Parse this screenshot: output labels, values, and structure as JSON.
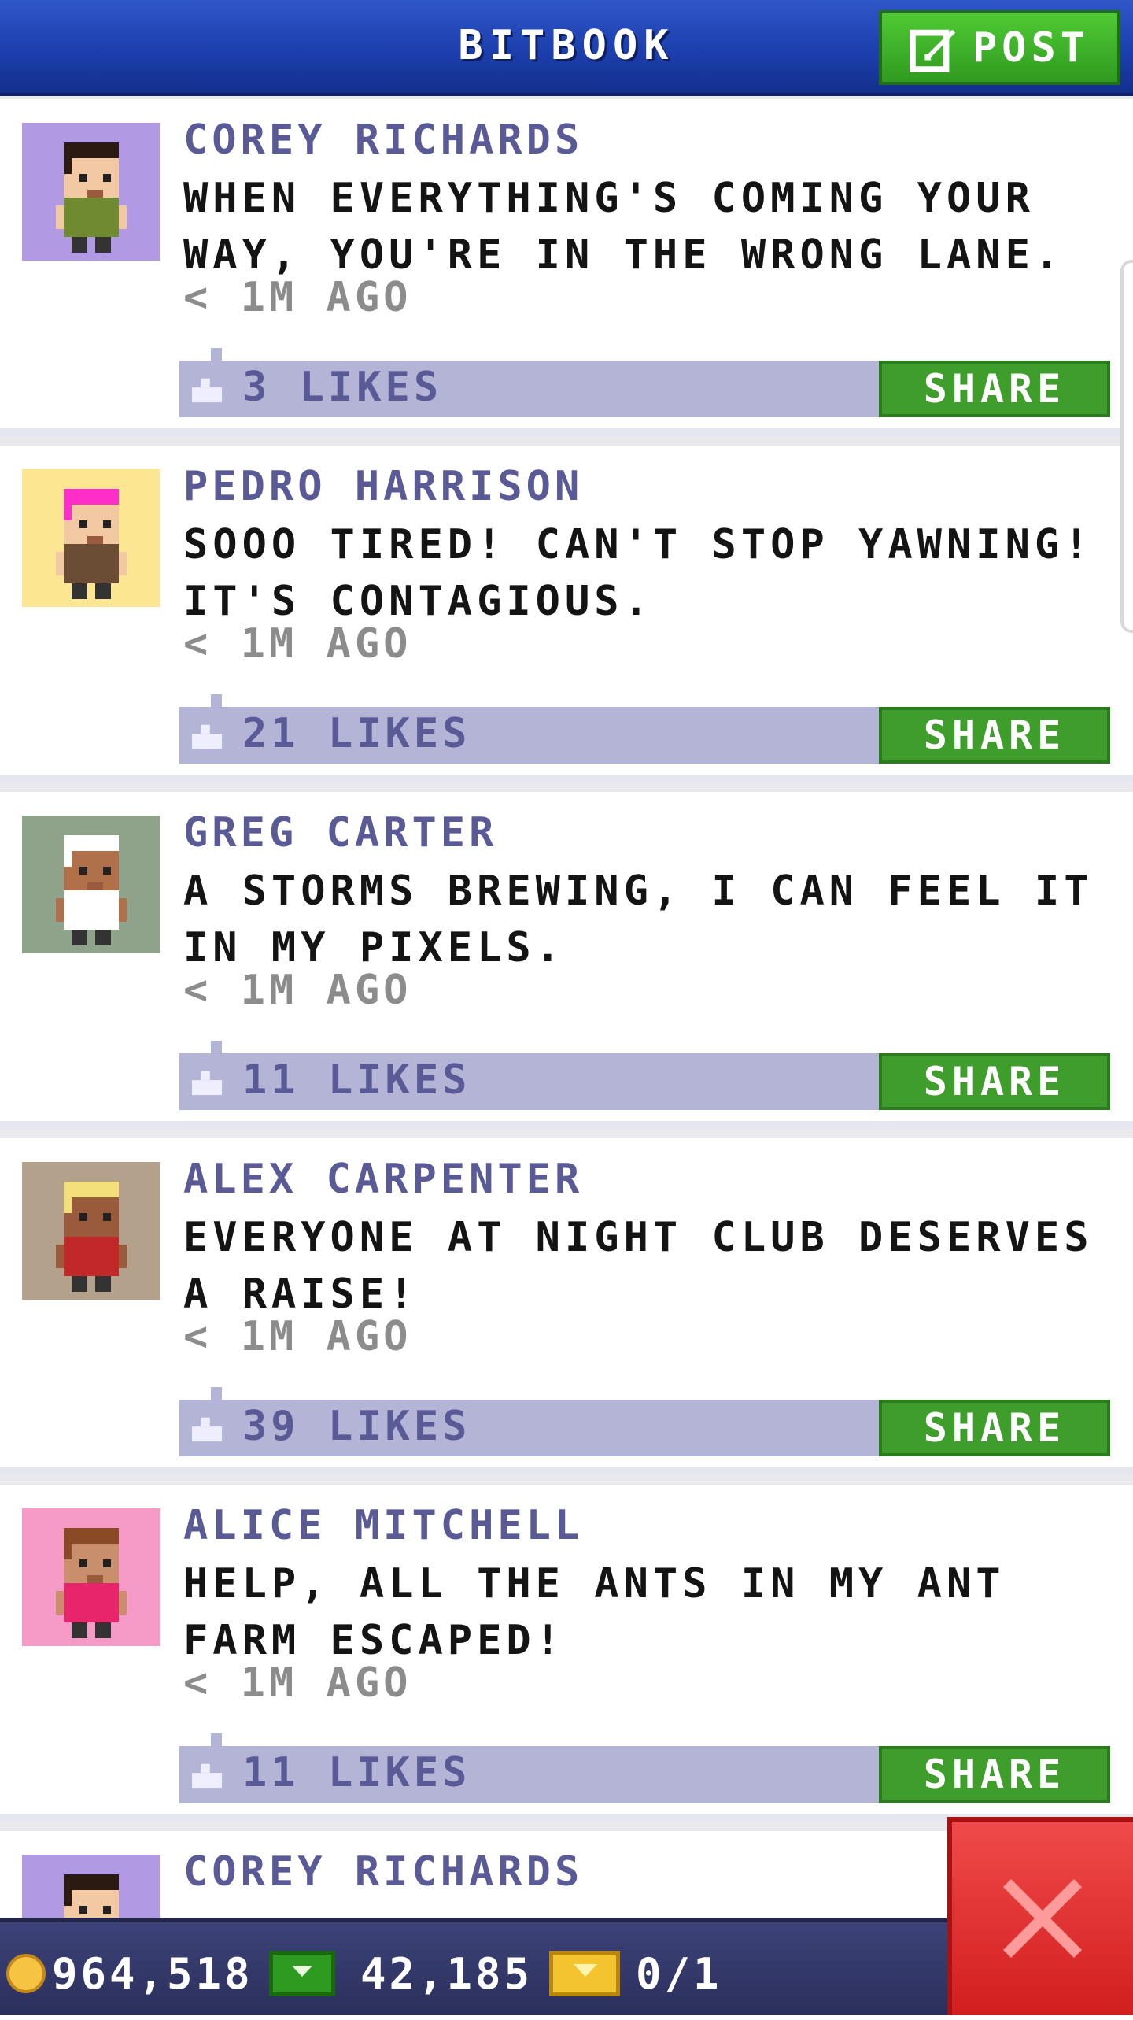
{
  "header": {
    "title": "BITBOOK",
    "post_label": "POST"
  },
  "posts": [
    {
      "author": "COREY RICHARDS",
      "text": "WHEN EVERYTHING'S COMING YOUR WAY, YOU'RE IN THE WRONG LANE.",
      "time": "< 1M AGO",
      "likes": "3 LIKES",
      "share": "SHARE",
      "avatar_bg": "#b19ae3",
      "avatar_shirt": "#6f8a2f",
      "avatar_hair": "#2a1a12",
      "avatar_skin": "#f2c9a3"
    },
    {
      "author": "PEDRO HARRISON",
      "text": "SOOO TIRED! CAN'T STOP YAWNING! IT'S CONTAGIOUS.",
      "time": "< 1M AGO",
      "likes": "21 LIKES",
      "share": "SHARE",
      "avatar_bg": "#fde692",
      "avatar_shirt": "#6b4c35",
      "avatar_hair": "#ff2ec8",
      "avatar_skin": "#f2c9a3"
    },
    {
      "author": "GREG CARTER",
      "text": "A STORMS BREWING, I CAN FEEL IT IN MY PIXELS.",
      "time": "< 1M AGO",
      "likes": "11 LIKES",
      "share": "SHARE",
      "avatar_bg": "#8fa28a",
      "avatar_shirt": "#ffffff",
      "avatar_hair": "#ffffff",
      "avatar_skin": "#b0714a"
    },
    {
      "author": "ALEX CARPENTER",
      "text": "EVERYONE AT NIGHT CLUB DESERVES A RAISE!",
      "time": "< 1M AGO",
      "likes": "39 LIKES",
      "share": "SHARE",
      "avatar_bg": "#b3a18b",
      "avatar_shirt": "#c0282a",
      "avatar_hair": "#f3e07a",
      "avatar_skin": "#9a5a3c"
    },
    {
      "author": "ALICE MITCHELL",
      "text": "HELP, ALL THE ANTS IN MY ANT FARM ESCAPED!",
      "time": "< 1M AGO",
      "likes": "11 LIKES",
      "share": "SHARE",
      "avatar_bg": "#f69ac8",
      "avatar_shirt": "#e8246b",
      "avatar_hair": "#8a4a25",
      "avatar_skin": "#c98e6b"
    },
    {
      "author": "COREY RICHARDS",
      "text": "",
      "time": "",
      "likes": "",
      "share": "",
      "avatar_bg": "#b19ae3",
      "avatar_shirt": "#6f8a2f",
      "avatar_hair": "#2a1a12",
      "avatar_skin": "#f2c9a3"
    }
  ],
  "footer": {
    "coins": "964,518",
    "bux": "42,185",
    "tickets": "0/1"
  },
  "icons": {
    "post": "edit-icon",
    "like": "thumbs-up-icon",
    "coin": "coin-icon",
    "bux": "bux-icon",
    "ticket": "ticket-icon",
    "close": "close-icon"
  }
}
